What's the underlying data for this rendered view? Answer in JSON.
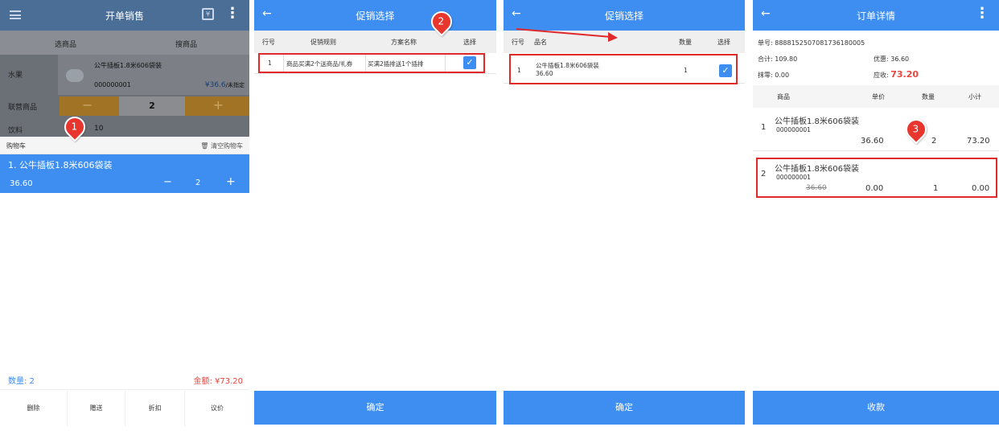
{
  "screen1": {
    "title": "开单销售",
    "tab_select": "选商品",
    "tab_scan": "搜商品",
    "categories": [
      "水果",
      "联营商品",
      "饮料"
    ],
    "product": {
      "name": "公牛插板1.8米606袋装",
      "code": "000000001",
      "price": "¥36.6",
      "price_note": "/未指定"
    },
    "stepper_qty": "2",
    "next_code": "10",
    "cart_label": "购物车",
    "clear_cart": "清空购物车",
    "cart_item": {
      "name": "1. 公牛插板1.8米606袋装",
      "price": "36.60",
      "qty": "2"
    },
    "qty_summary": "数量: 2",
    "amount_summary": "金额: ¥73.20",
    "buttons": [
      "删除",
      "赠送",
      "折扣",
      "议价"
    ],
    "pin": "1",
    "icons": {
      "minus": "−",
      "plus": "+",
      "edit": "¥"
    }
  },
  "screen2": {
    "title": "促销选择",
    "headers": [
      "行号",
      "促销规则",
      "方案名称",
      "选择"
    ],
    "row": {
      "no": "1",
      "rule": "商品买满2个送商品/礼券",
      "plan": "买满2插排送1个插排"
    },
    "confirm": "确定",
    "pin": "2",
    "check": "✓"
  },
  "screen3": {
    "title": "促销选择",
    "headers": [
      "行号",
      "品名",
      "数量",
      "选择"
    ],
    "row": {
      "no": "1",
      "name": "公牛插板1.8米606袋装",
      "price": "36.60",
      "qty": "1"
    },
    "confirm": "确定",
    "check": "✓"
  },
  "screen4": {
    "title": "订单详情",
    "order_no": "单号: 8888152507081736180005",
    "total": "合计: 109.80",
    "discount": "优惠: 36.60",
    "rounding": "抹零: 0.00",
    "receivable_label": "应收:",
    "receivable_value": "73.20",
    "headers": [
      "商品",
      "单价",
      "数量",
      "小计"
    ],
    "items": [
      {
        "no": "1",
        "name": "公牛插板1.8米606袋装",
        "code": "000000001",
        "orig_price": "",
        "price": "36.60",
        "qty": "2",
        "subtotal": "73.20"
      },
      {
        "no": "2",
        "name": "公牛插板1.8米606袋装",
        "code": "000000001",
        "orig_price": "36.60",
        "price": "0.00",
        "qty": "1",
        "subtotal": "0.00"
      }
    ],
    "collect": "收款",
    "pin": "3"
  },
  "colors": {
    "primary": "#3d8ef0",
    "red": "#e8352d",
    "amount": "#e8463e"
  }
}
